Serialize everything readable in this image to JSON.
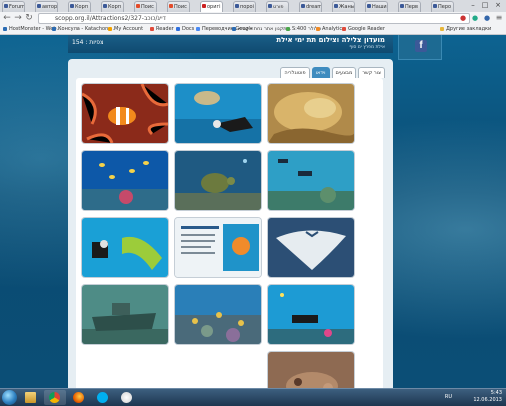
{
  "browser": {
    "tabs": [
      {
        "label": "Forum",
        "favicon_color": "#3b5998"
      },
      {
        "label": "автор",
        "favicon_color": "#3b5998"
      },
      {
        "label": "Корп",
        "favicon_color": "#3b5998"
      },
      {
        "label": "Корп",
        "favicon_color": "#3b5998"
      },
      {
        "label": "Поис",
        "favicon_color": "#e34b2a"
      },
      {
        "label": "Поис",
        "favicon_color": "#e34b2a"
      },
      {
        "label": "оригі",
        "favicon_color": "#cc2222"
      },
      {
        "label": "пороі",
        "favicon_color": "#3b5998"
      },
      {
        "label": "פורט",
        "favicon_color": "#3b5998"
      },
      {
        "label": "dream",
        "favicon_color": "#3b5998"
      },
      {
        "label": "Жаны",
        "favicon_color": "#3b5998"
      },
      {
        "label": "Наши",
        "favicon_color": "#3b5998"
      },
      {
        "label": "Перв",
        "favicon_color": "#3b5998"
      },
      {
        "label": "Перо",
        "favicon_color": "#3b5998"
      }
    ],
    "url": "scopp.org.il/Attractions2/327-דייג/כוכב",
    "bookmarks": [
      {
        "label": "HostMonster - Web...",
        "color": "#2a6bb3"
      },
      {
        "label": "Консула - Katachons...",
        "color": "#2a6bb3"
      },
      {
        "label": "My Account",
        "color": "#f4a300"
      },
      {
        "label": "Reader",
        "color": "#e04a3a"
      },
      {
        "label": "Docs",
        "color": "#2f6fdc"
      },
      {
        "label": "Переводчик Google",
        "color": "#4a8af4"
      },
      {
        "label": "תקנון אתר נחת - ישרא...",
        "color": "#2a6bb3"
      },
      {
        "label": "S:400 סלולר",
        "color": "#4aa64a"
      },
      {
        "label": "Analytics",
        "color": "#f08a24"
      },
      {
        "label": "Google Reader",
        "color": "#e04a3a"
      },
      {
        "label": "Другие закладки",
        "color": "#e8b73a"
      }
    ]
  },
  "site": {
    "title": "מועדון צלילה וצילום תת ימי אילת",
    "subtitle": "אילת מפרץ ים סוף",
    "page_count": "154 : צפיות"
  },
  "content_tabs": [
    {
      "label": "צור קשר",
      "active": false
    },
    {
      "label": "מבצעים",
      "active": false
    },
    {
      "label": "וידאו",
      "active": true
    },
    {
      "label": "פוטוגלריה",
      "active": false
    }
  ],
  "gallery": [
    {
      "alt": "ray-on-sand"
    },
    {
      "alt": "diver-with-turtle"
    },
    {
      "alt": "clownfish-anemone"
    },
    {
      "alt": "divers-over-reef"
    },
    {
      "alt": "green-turtle-coral"
    },
    {
      "alt": "reef-fish-school"
    },
    {
      "alt": "manta-ray"
    },
    {
      "alt": "diving-club-flyer"
    },
    {
      "alt": "diver-with-moray"
    },
    {
      "alt": "diver-at-reef"
    },
    {
      "alt": "coral-garden"
    },
    {
      "alt": "shipwreck"
    },
    {
      "alt": "stonefish-closeup"
    }
  ],
  "taskbar": {
    "language": "RU",
    "time": "5:43",
    "date": "12.06.2013"
  }
}
